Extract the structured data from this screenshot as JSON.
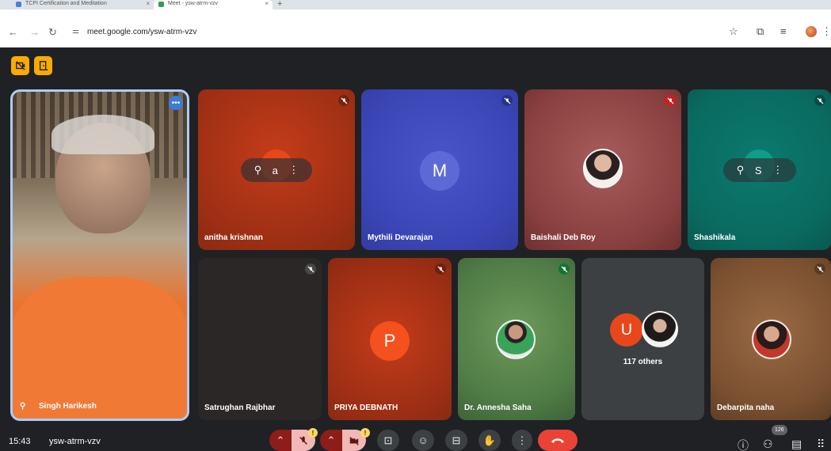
{
  "browser": {
    "tabs": [
      {
        "label": "TCPI Certification and Meditation"
      },
      {
        "label": "Meet - ysw-atrm-vzv"
      }
    ],
    "url": "meet.google.com/ysw-atrm-vzv"
  },
  "meeting": {
    "time": "15:43",
    "code": "ysw-atrm-vzv",
    "participants_count": "126"
  },
  "tiles": {
    "speaker": {
      "name": "Singh Harikesh"
    },
    "anitha": {
      "name": "anitha krishnan",
      "initial": "a"
    },
    "mythili": {
      "name": "Mythili Devarajan",
      "initial": "M"
    },
    "baishali": {
      "name": "Baishali Deb Roy"
    },
    "shashikala": {
      "name": "Shashikala",
      "initial": "S"
    },
    "satrughan": {
      "name": "Satrughan Rajbhar"
    },
    "priya": {
      "name": "PRIYA DEBNATH",
      "initial": "P"
    },
    "annesha": {
      "name": "Dr. Annesha Saha"
    },
    "others": {
      "initial": "U",
      "label": "117 others"
    },
    "debarpita": {
      "name": "Debarpita naha"
    }
  },
  "controls": {
    "warning": "!"
  },
  "colors": {
    "accent": "#f9ab00",
    "end_call": "#ea4335",
    "speaking_border": "#aecbfa",
    "mic_off_pink": "#f2b8b5"
  }
}
